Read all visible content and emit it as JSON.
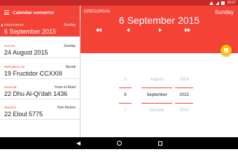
{
  "status_bar": {
    "time": "10:27",
    "icons": [
      "wifi-icon",
      "signal-icon",
      "battery-icon"
    ]
  },
  "app": {
    "title": "Calendar converter",
    "accent": "#f44336",
    "fab_color": "#ffc107"
  },
  "calendars": [
    {
      "name": "GREGORIAN",
      "day": "Sunday",
      "date": "6 September 2015",
      "selected": true
    },
    {
      "name": "JULIAN",
      "day": "Sunday",
      "date": "24 August 2015"
    },
    {
      "name": "REPUBLICAN",
      "day": "Nonidi",
      "date": "19 Fructidor CCXXIII"
    },
    {
      "name": "MUSLIM",
      "day": "Youm el Ahad",
      "date": "22 Dhu Al-Qi'dah 1436"
    },
    {
      "name": "JEWISH",
      "day": "Yom Rishon",
      "date": "22 Eloul 5775"
    }
  ],
  "main": {
    "calendar": "GREGORIAN",
    "day": "Sunday",
    "date": "6 September 2015"
  },
  "picker": {
    "day": [
      "5",
      "6",
      "7"
    ],
    "month": [
      "August",
      "September",
      "October"
    ],
    "year": [
      "2014",
      "2015",
      "2016"
    ]
  }
}
